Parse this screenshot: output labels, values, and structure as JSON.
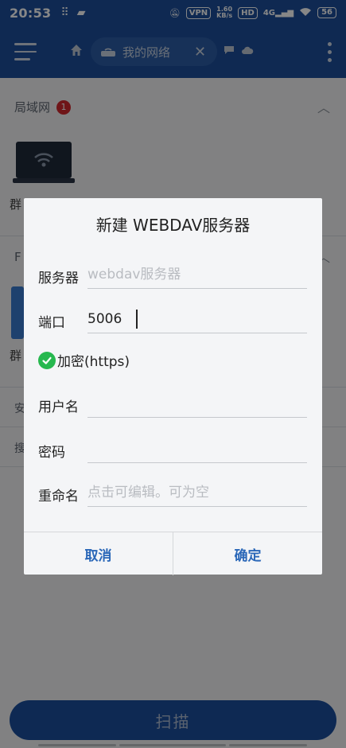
{
  "status_bar": {
    "time": "20:53",
    "vpn": "VPN",
    "speed_value": "1.60",
    "speed_unit": "KB/s",
    "hd": "HD",
    "network": "4G",
    "battery": "56"
  },
  "app_bar": {
    "nav_chip_label": "我的网络"
  },
  "background": {
    "section_lan": "局域网",
    "section_lan_badge": "1",
    "device_label_1": "群",
    "ftp_header": "F",
    "device_label_2": "群",
    "row_1": "安",
    "row_2": "搜",
    "scan_button": "扫描"
  },
  "dialog": {
    "title": "新建 WEBDAV服务器",
    "server_label": "服务器",
    "server_placeholder": "webdav服务器",
    "server_value": "",
    "port_label": "端口",
    "port_value": "5006",
    "encrypt_label": "加密(https)",
    "encrypt_checked": true,
    "username_label": "用户名",
    "username_value": "",
    "password_label": "密码",
    "password_value": "",
    "rename_label": "重命名",
    "rename_placeholder": "点击可编辑。可为空",
    "cancel_label": "取消",
    "confirm_label": "确定"
  },
  "colors": {
    "primary": "#1d4f9c",
    "accent_text": "#2a67b8",
    "check_green": "#27b84f",
    "badge_red": "#d2282e"
  }
}
